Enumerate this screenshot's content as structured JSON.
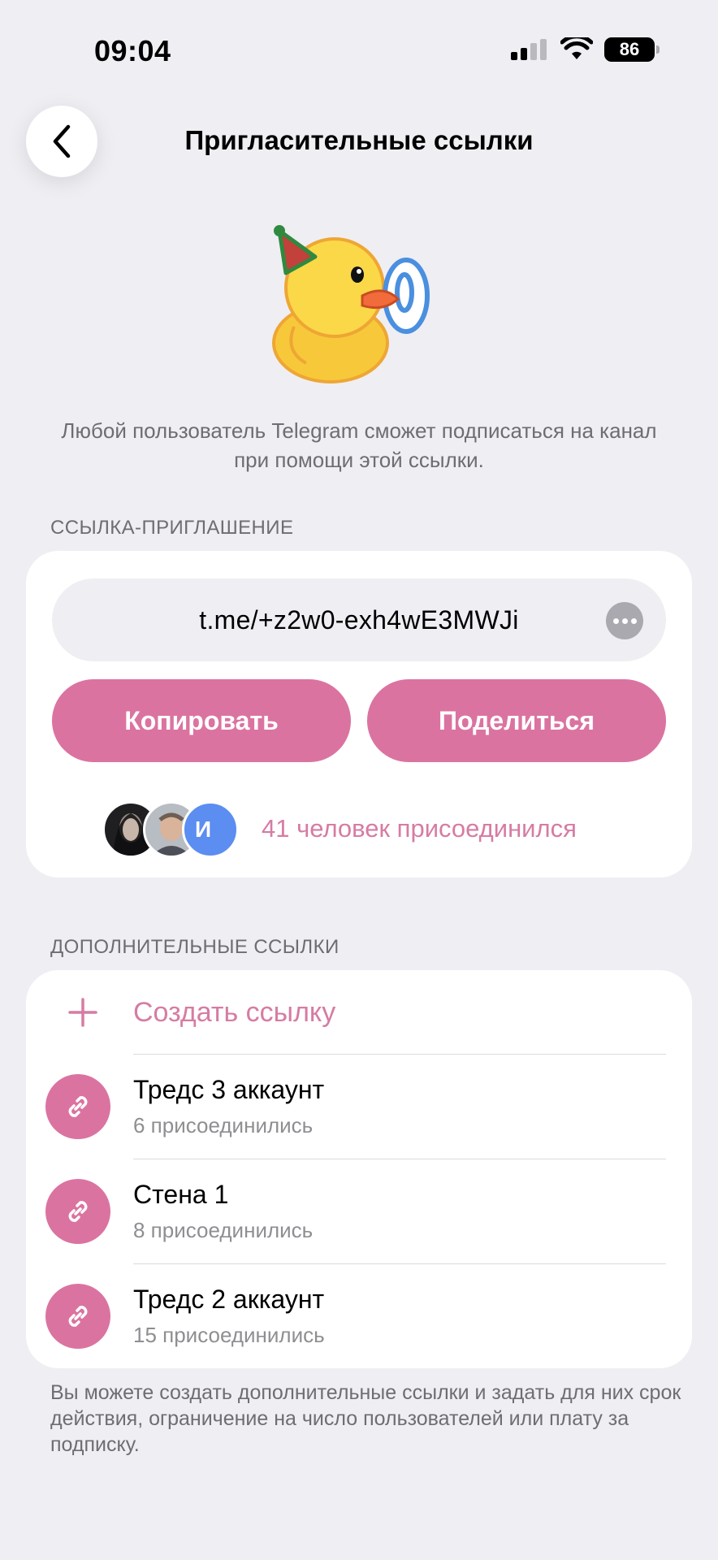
{
  "status_bar": {
    "time": "09:04",
    "battery": "86",
    "icons": [
      "cellular-signal-icon",
      "wifi-icon",
      "battery-icon"
    ]
  },
  "header": {
    "title": "Пригласительные ссылки",
    "back_icon": "chevron-left-icon"
  },
  "description": "Любой пользователь Telegram сможет подписаться на канал при помощи этой ссылки.",
  "invite_link": {
    "section_label": "ССЫЛКА-ПРИГЛАШЕНИЕ",
    "link": "t.me/+z2w0-exh4wE3MWJi",
    "copy_label": "Копировать",
    "share_label": "Поделиться",
    "avatar_letter": "И",
    "joined_text": "41 человек присоединился"
  },
  "additional_links": {
    "section_label": "ДОПОЛНИТЕЛЬНЫЕ ССЫЛКИ",
    "create_label": "Создать ссылку",
    "items": [
      {
        "title": "Тредс 3 аккаунт",
        "subtitle": "6 присоединились"
      },
      {
        "title": "Стена 1",
        "subtitle": "8 присоединились"
      },
      {
        "title": "Тредс 2 аккаунт",
        "subtitle": "15 присоединились"
      }
    ]
  },
  "footer": "Вы можете создать дополнительные ссылки и задать для них срок действия, ограничение на число пользователей или плату за подписку.",
  "colors": {
    "accent": "#db73a1",
    "accent_text": "#d67ca3",
    "background": "#efeef3",
    "card": "#ffffff",
    "secondary_text": "#6d6d72"
  }
}
